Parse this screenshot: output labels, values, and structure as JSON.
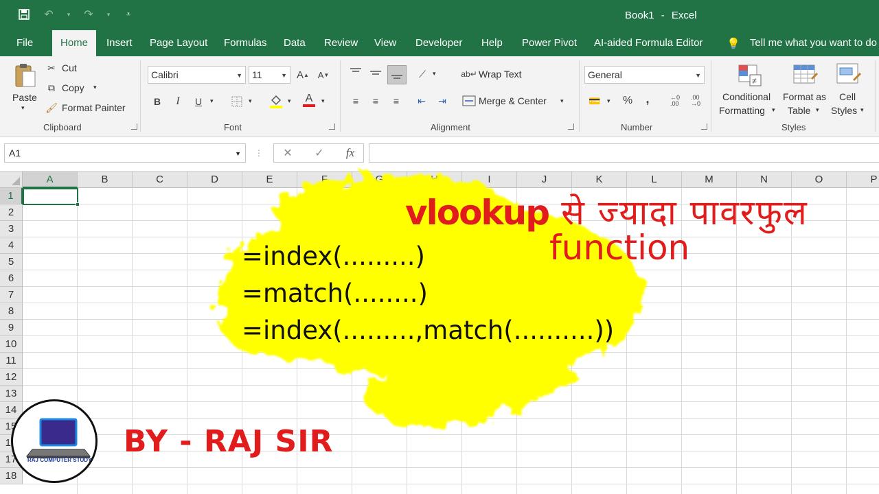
{
  "window": {
    "doc_name": "Book1",
    "separator": "-",
    "app_name": "Excel"
  },
  "tabs": [
    "File",
    "Home",
    "Insert",
    "Page Layout",
    "Formulas",
    "Data",
    "Review",
    "View",
    "Developer",
    "Help",
    "Power Pivot",
    "AI-aided Formula Editor"
  ],
  "active_tab": "Home",
  "tell_me": "Tell me what you want to do",
  "clipboard": {
    "paste": "Paste",
    "cut": "Cut",
    "copy": "Copy",
    "format_painter": "Format Painter",
    "label": "Clipboard"
  },
  "font": {
    "name": "Calibri",
    "size": "11",
    "bold": "B",
    "italic": "I",
    "underline": "U",
    "label": "Font"
  },
  "alignment": {
    "wrap_text": "Wrap Text",
    "merge_center": "Merge & Center",
    "label": "Alignment"
  },
  "number": {
    "format": "General",
    "percent": "%",
    "comma": ",",
    "label": "Number"
  },
  "styles": {
    "cond_1": "Conditional",
    "cond_2": "Formatting",
    "fmt_1": "Format as",
    "fmt_2": "Table",
    "cell_1": "Cell",
    "cell_2": "Styles",
    "label": "Styles"
  },
  "formula_bar": {
    "name_box": "A1",
    "cancel": "✕",
    "enter": "✓",
    "fx": "fx",
    "value": ""
  },
  "sheet": {
    "columns": [
      "A",
      "B",
      "C",
      "D",
      "E",
      "F",
      "G",
      "H",
      "I",
      "J",
      "K",
      "L",
      "M",
      "N",
      "O",
      "P"
    ],
    "rows": [
      "1",
      "2",
      "3",
      "4",
      "5",
      "6",
      "7",
      "8",
      "9",
      "10",
      "11",
      "12",
      "13",
      "14",
      "15",
      "16",
      "17",
      "18"
    ],
    "active_cell": "A1"
  },
  "overlay": {
    "headline_latin": "vlookup",
    "headline_hindi": "से ज्यादा पावरफुल",
    "subline": "function",
    "formula_1": "=index(.........)",
    "formula_2": "=match(........)",
    "formula_3": "=index(.........,match(..........))",
    "byline": "BY - RAJ SIR",
    "logo_text": "RAJ COMPUTER STUDY"
  },
  "colors": {
    "excel_green": "#217346",
    "accent_red": "#e01c1c",
    "splash_yellow": "#ffff00"
  }
}
